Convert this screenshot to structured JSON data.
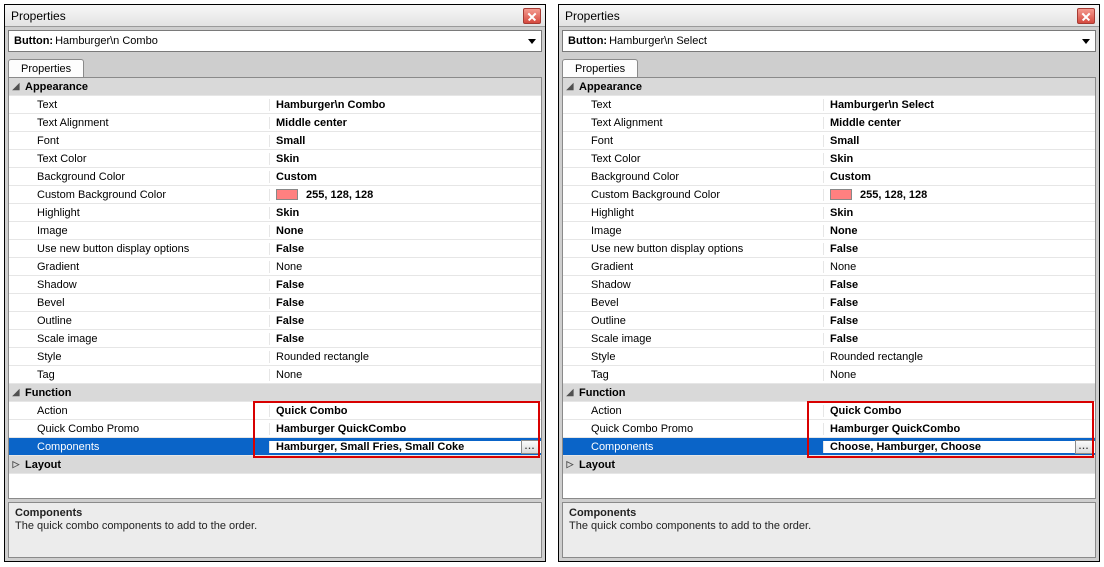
{
  "panels": [
    {
      "window_title": "Properties",
      "selector_label": "Button:",
      "selector_value": "Hamburger\\n Combo",
      "tab_label": "Properties",
      "sections": {
        "appearance_label": "Appearance",
        "function_label": "Function",
        "layout_label": "Layout"
      },
      "rows": {
        "text_label": "Text",
        "text_value": "Hamburger\\n Combo",
        "align_label": "Text Alignment",
        "align_value": "Middle center",
        "font_label": "Font",
        "font_value": "Small",
        "tcolor_label": "Text Color",
        "tcolor_value": "Skin",
        "bgcolor_label": "Background Color",
        "bgcolor_value": "Custom",
        "cbg_label": "Custom Background Color",
        "cbg_value": "255, 128, 128",
        "hl_label": "Highlight",
        "hl_value": "Skin",
        "img_label": "Image",
        "img_value": "None",
        "unbdo_label": "Use new button display options",
        "unbdo_value": "False",
        "grad_label": "Gradient",
        "grad_value": "None",
        "shadow_label": "Shadow",
        "shadow_value": "False",
        "bevel_label": "Bevel",
        "bevel_value": "False",
        "outline_label": "Outline",
        "outline_value": "False",
        "scale_label": "Scale image",
        "scale_value": "False",
        "style_label": "Style",
        "style_value": "Rounded rectangle",
        "tag_label": "Tag",
        "tag_value": "None",
        "action_label": "Action",
        "action_value": "Quick Combo",
        "promo_label": "Quick Combo Promo",
        "promo_value": "Hamburger QuickCombo",
        "comp_label": "Components",
        "comp_value": "Hamburger, Small Fries, Small Coke"
      },
      "desc_title": "Components",
      "desc_body": "The quick combo components to add to the order."
    },
    {
      "window_title": "Properties",
      "selector_label": "Button:",
      "selector_value": "Hamburger\\n Select",
      "tab_label": "Properties",
      "sections": {
        "appearance_label": "Appearance",
        "function_label": "Function",
        "layout_label": "Layout"
      },
      "rows": {
        "text_label": "Text",
        "text_value": "Hamburger\\n Select",
        "align_label": "Text Alignment",
        "align_value": "Middle center",
        "font_label": "Font",
        "font_value": "Small",
        "tcolor_label": "Text Color",
        "tcolor_value": "Skin",
        "bgcolor_label": "Background Color",
        "bgcolor_value": "Custom",
        "cbg_label": "Custom Background Color",
        "cbg_value": "255, 128, 128",
        "hl_label": "Highlight",
        "hl_value": "Skin",
        "img_label": "Image",
        "img_value": "None",
        "unbdo_label": "Use new button display options",
        "unbdo_value": "False",
        "grad_label": "Gradient",
        "grad_value": "None",
        "shadow_label": "Shadow",
        "shadow_value": "False",
        "bevel_label": "Bevel",
        "bevel_value": "False",
        "outline_label": "Outline",
        "outline_value": "False",
        "scale_label": "Scale image",
        "scale_value": "False",
        "style_label": "Style",
        "style_value": "Rounded rectangle",
        "tag_label": "Tag",
        "tag_value": "None",
        "action_label": "Action",
        "action_value": "Quick Combo",
        "promo_label": "Quick Combo Promo",
        "promo_value": "Hamburger QuickCombo",
        "comp_label": "Components",
        "comp_value": "Choose, Hamburger, Choose"
      },
      "desc_title": "Components",
      "desc_body": "The quick combo components to add to the order."
    }
  ],
  "ellipsis": "..."
}
